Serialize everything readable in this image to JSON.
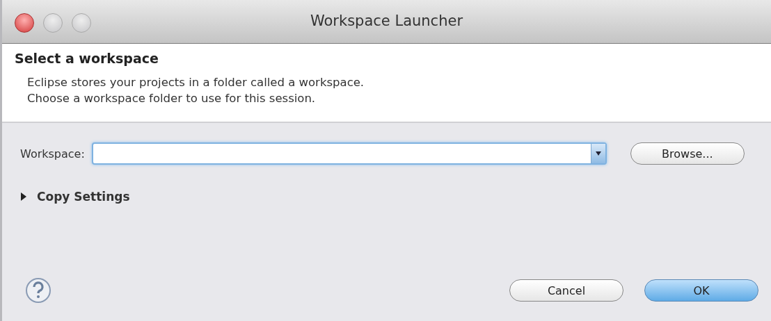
{
  "window": {
    "title": "Workspace Launcher"
  },
  "header": {
    "title": "Select a workspace",
    "description_lines": [
      "Eclipse stores your projects in a folder called a workspace.",
      "Choose a workspace folder to use for this session."
    ]
  },
  "workspace": {
    "label": "Workspace:",
    "browse_button": "Browse..."
  },
  "copy_settings": {
    "label": "Copy Settings",
    "expanded": false
  },
  "buttons": [
    {
      "label": "Cancel",
      "kind": "normal"
    },
    {
      "label": "OK",
      "kind": "default"
    }
  ]
}
